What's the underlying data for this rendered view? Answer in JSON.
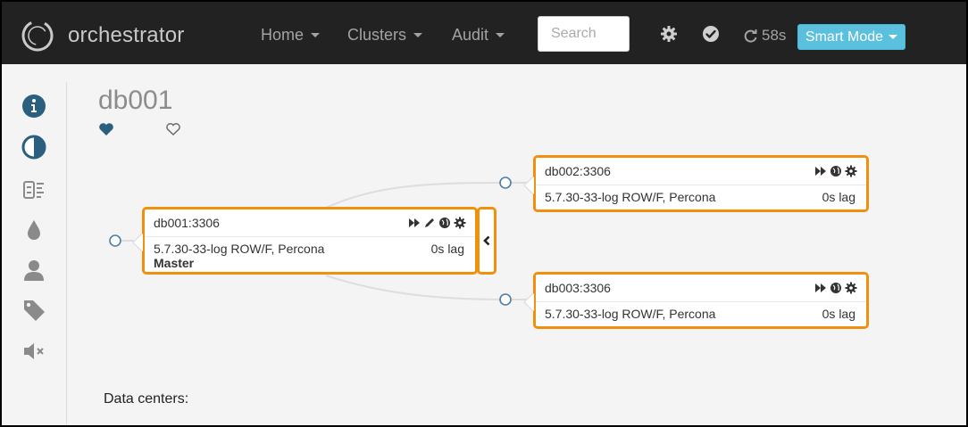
{
  "navbar": {
    "brand": "orchestrator",
    "menu": [
      {
        "label": "Home"
      },
      {
        "label": "Clusters"
      },
      {
        "label": "Audit"
      }
    ],
    "search_placeholder": "Search",
    "icons": [
      "gear-icon",
      "check-circle-icon"
    ],
    "refresh_countdown": "58s",
    "mode_button": "Smart Mode"
  },
  "sidebar": {
    "icons": [
      "info-icon",
      "contrast-icon",
      "server-list-icon",
      "tint-icon",
      "user-icon",
      "tag-icon",
      "volume-off-icon"
    ]
  },
  "page": {
    "title": "db001",
    "data_centers_label": "Data centers:"
  },
  "nodes": [
    {
      "name": "db001:3306",
      "version": "5.7.30-33-log ROW/F, Percona",
      "lag": "0s lag",
      "role": "Master"
    },
    {
      "name": "db002:3306",
      "version": "5.7.30-33-log ROW/F, Percona",
      "lag": "0s lag",
      "role": ""
    },
    {
      "name": "db003:3306",
      "version": "5.7.30-33-log ROW/F, Percona",
      "lag": "0s lag",
      "role": ""
    }
  ],
  "colors": {
    "navbar": "#222222",
    "node_border": "#f0900d",
    "accent": "#5bc0de",
    "sidebar_icon": "#2a5f7f",
    "connector": "#4a7fa8"
  }
}
